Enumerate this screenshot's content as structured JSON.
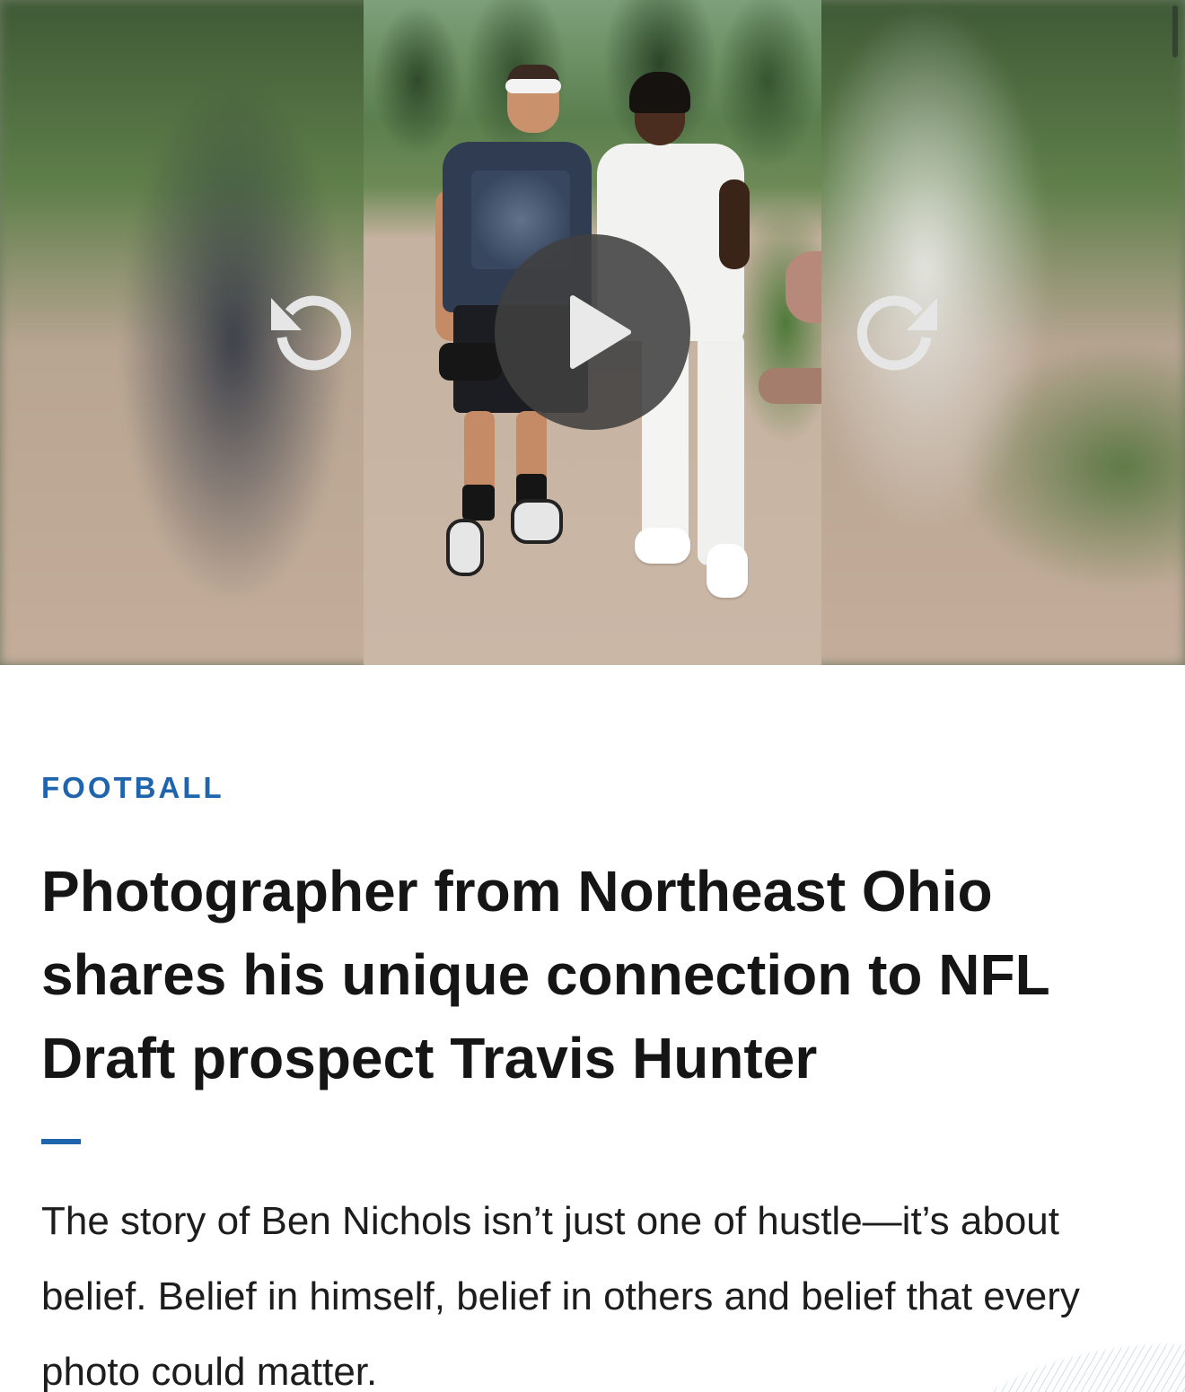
{
  "video": {
    "icons": {
      "rewind": "rewind-icon",
      "play": "play-icon",
      "forward": "fast-forward-icon"
    }
  },
  "article": {
    "category": "FOOTBALL",
    "headline": "Photographer from Northeast Ohio shares his unique connection to NFL Draft prospect Travis Hunter",
    "lede": "The story of Ben Nichols isn’t just one of hustle—it’s about belief. Belief in himself, belief in others and belief that every photo could matter."
  },
  "colors": {
    "accent": "#1e65ad",
    "headline": "#151515",
    "body_text": "#1d1d1d"
  }
}
